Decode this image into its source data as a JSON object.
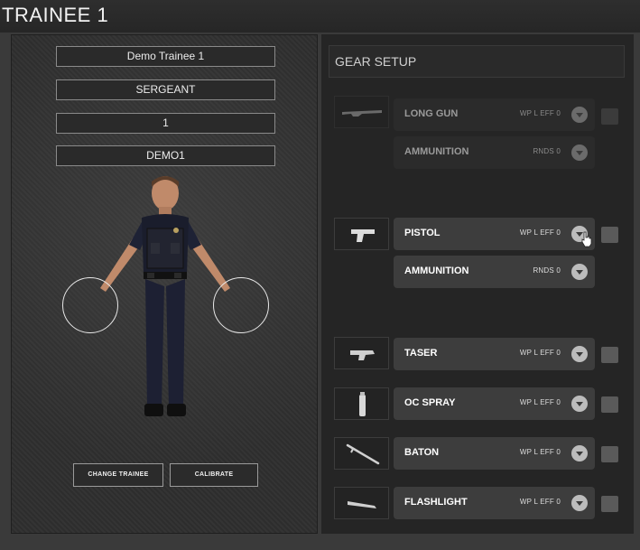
{
  "title": "TRAINEE 1",
  "trainee": {
    "name": "Demo Trainee 1",
    "rank": "SERGEANT",
    "number": "1",
    "id": "DEMO1"
  },
  "buttons": {
    "change_trainee": "CHANGE TRAINEE",
    "calibrate": "CALIBRATE"
  },
  "gear": {
    "header": "GEAR SETUP",
    "items": [
      {
        "label": "LONG GUN",
        "meta": "WP L  EFF 0",
        "active": false
      },
      {
        "label": "AMMUNITION",
        "meta": "RNDS 0",
        "active": false
      },
      {
        "label": "PISTOL",
        "meta": "WP L  EFF 0",
        "active": true
      },
      {
        "label": "AMMUNITION",
        "meta": "RNDS 0",
        "active": true
      },
      {
        "label": "TASER",
        "meta": "WP L  EFF 0",
        "active": true
      },
      {
        "label": "OC SPRAY",
        "meta": "WP L  EFF 0",
        "active": true
      },
      {
        "label": "BATON",
        "meta": "WP L  EFF 0",
        "active": true
      },
      {
        "label": "FLASHLIGHT",
        "meta": "WP L  EFF 0",
        "active": true
      }
    ]
  },
  "icons": {
    "dropdown": "chevron-down-icon",
    "long_gun": "rifle-icon",
    "pistol": "pistol-icon",
    "taser": "taser-icon",
    "oc_spray": "spray-can-icon",
    "baton": "baton-icon",
    "flashlight": "flashlight-icon"
  },
  "colors": {
    "panel_bg": "#2f2f2f",
    "row_active": "#3d3d3d",
    "row_inactive": "#2b2b2b"
  }
}
